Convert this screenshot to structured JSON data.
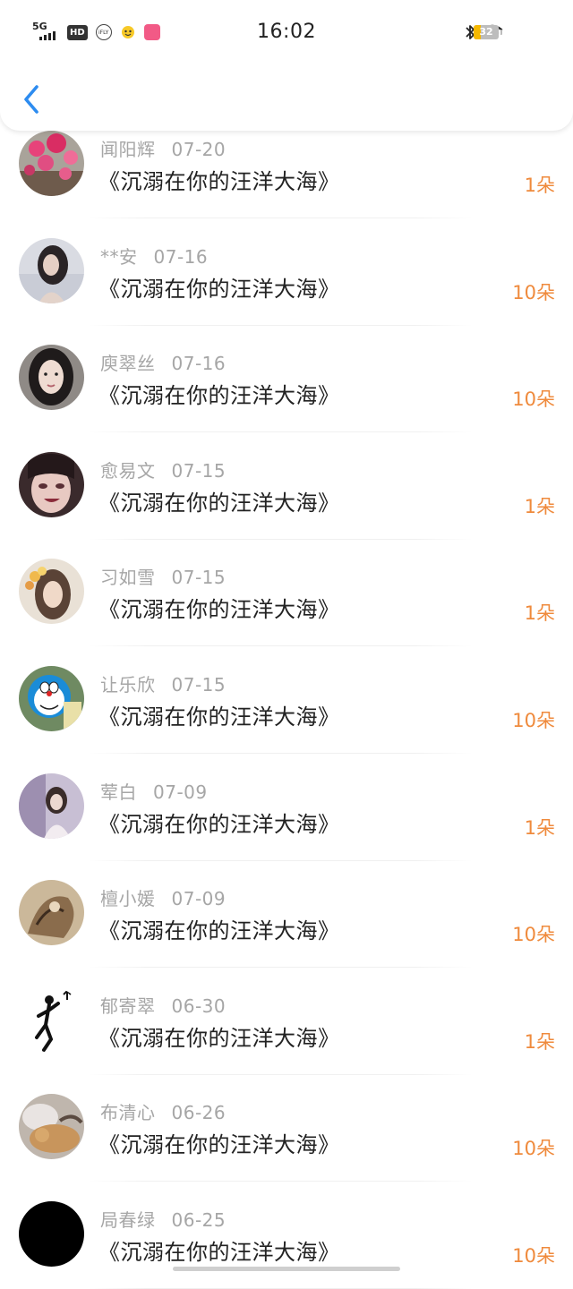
{
  "status_bar": {
    "network": "5G",
    "hd_badge": "HD",
    "app_icon_label": "iFLY",
    "time": "16:02",
    "battery": "32"
  },
  "header": {
    "back_icon": "chevron-left-icon"
  },
  "colors": {
    "amount": "#ef8a3c",
    "name": "#a6a6a6",
    "title": "#222222",
    "back": "#2d8cf0"
  },
  "gifts": [
    {
      "name": "闻阳辉",
      "date": "07-20",
      "title": "《沉溺在你的汪洋大海》",
      "amount": "1朵",
      "avatar": "pink-flowers"
    },
    {
      "name": "**安",
      "date": "07-16",
      "title": "《沉溺在你的汪洋大海》",
      "amount": "10朵",
      "avatar": "woman-dark-hair"
    },
    {
      "name": "庾翠丝",
      "date": "07-16",
      "title": "《沉溺在你的汪洋大海》",
      "amount": "10朵",
      "avatar": "woman-selfie"
    },
    {
      "name": "愈易文",
      "date": "07-15",
      "title": "《沉溺在你的汪洋大海》",
      "amount": "1朵",
      "avatar": "anime-girl"
    },
    {
      "name": "习如雪",
      "date": "07-15",
      "title": "《沉溺在你的汪洋大海》",
      "amount": "1朵",
      "avatar": "woman-flower-crown"
    },
    {
      "name": "让乐欣",
      "date": "07-15",
      "title": "《沉溺在你的汪洋大海》",
      "amount": "10朵",
      "avatar": "doraemon"
    },
    {
      "name": "荤白",
      "date": "07-09",
      "title": "《沉溺在你的汪洋大海》",
      "amount": "1朵",
      "avatar": "girl-purple"
    },
    {
      "name": "檀小媛",
      "date": "07-09",
      "title": "《沉溺在你的汪洋大海》",
      "amount": "10朵",
      "avatar": "sketch-art"
    },
    {
      "name": "郁寄翠",
      "date": "06-30",
      "title": "《沉溺在你的汪洋大海》",
      "amount": "1朵",
      "avatar": "stick-figure"
    },
    {
      "name": "布清心",
      "date": "06-26",
      "title": "《沉溺在你的汪洋大海》",
      "amount": "10朵",
      "avatar": "sleeping-cat"
    },
    {
      "name": "局春绿",
      "date": "06-25",
      "title": "《沉溺在你的汪洋大海》",
      "amount": "10朵",
      "avatar": "black-circle"
    }
  ]
}
